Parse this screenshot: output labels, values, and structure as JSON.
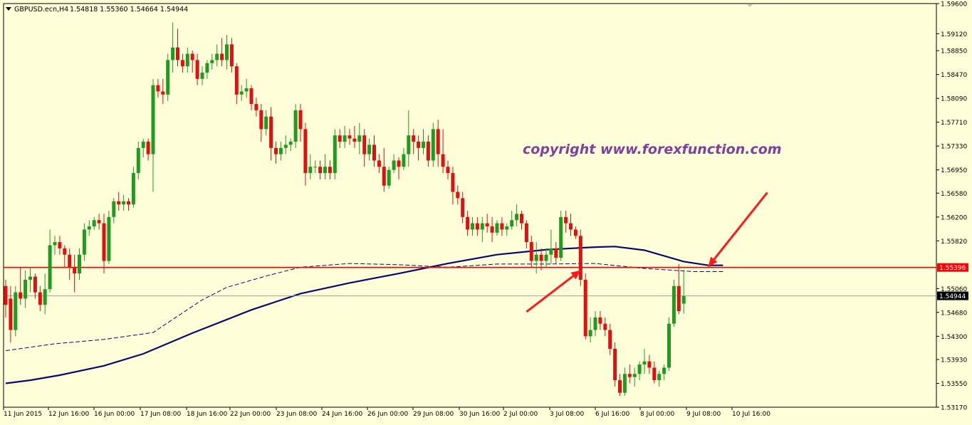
{
  "header": {
    "dropdown_icon": "triangle-down-icon",
    "symbol": "GBPUSD.ecn,H4",
    "ohlc": "1.54818 1.55360 1.54664 1.54944"
  },
  "watermark": "copyright  www.forexfunction.com",
  "colors": {
    "background": "#fefed8",
    "bull": "#1f9c1f",
    "bear": "#e01010",
    "ma": "#0a0a6e",
    "resistance": "#ff0000",
    "watermark": "#8040a0",
    "arrow": "#ff1a1a"
  },
  "chart_data": {
    "type": "candlestick",
    "instrument": "GBPUSD.ecn",
    "timeframe": "H4",
    "ylim": [
      1.5317,
      1.596
    ],
    "y_ticks": [
      "1.59600",
      "1.59120",
      "1.58850",
      "1.58470",
      "1.58090",
      "1.57710",
      "1.57330",
      "1.56950",
      "1.56580",
      "1.56200",
      "1.55820",
      "1.55060",
      "1.54680",
      "1.54300",
      "1.53930",
      "1.53550",
      "1.53170"
    ],
    "x_labels": [
      "11 Jun 2015",
      "12 Jun 16:00",
      "16 Jun 00:00",
      "17 Jun 08:00",
      "18 Jun 16:00",
      "22 Jun 00:00",
      "23 Jun 08:00",
      "24 Jun 16:00",
      "26 Jun 00:00",
      "29 Jun 08:00",
      "30 Jun 16:00",
      "2 Jul 00:00",
      "3 Jul 08:00",
      "6 Jul 16:00",
      "8 Jul 00:00",
      "9 Jul 08:00",
      "10 Jul 16:00"
    ],
    "resistance_level": {
      "label": "1.55396",
      "value": 1.55396
    },
    "current_price": {
      "label": "1.54944",
      "value": 1.54944
    },
    "candles": [
      [
        1.551,
        1.552,
        1.546,
        1.548
      ],
      [
        1.549,
        1.551,
        1.542,
        1.544
      ],
      [
        1.544,
        1.551,
        1.543,
        1.55
      ],
      [
        1.55,
        1.554,
        1.548,
        1.549
      ],
      [
        1.549,
        1.5535,
        1.5475,
        1.552
      ],
      [
        1.552,
        1.554,
        1.55,
        1.5525
      ],
      [
        1.5525,
        1.553,
        1.549,
        1.55
      ],
      [
        1.55,
        1.551,
        1.547,
        1.548
      ],
      [
        1.548,
        1.553,
        1.5465,
        1.5505
      ],
      [
        1.5505,
        1.56,
        1.55,
        1.5575
      ],
      [
        1.5575,
        1.559,
        1.556,
        1.558
      ],
      [
        1.558,
        1.559,
        1.556,
        1.557
      ],
      [
        1.557,
        1.5575,
        1.554,
        1.556
      ],
      [
        1.556,
        1.557,
        1.552,
        1.554
      ],
      [
        1.554,
        1.556,
        1.55,
        1.553
      ],
      [
        1.553,
        1.557,
        1.552,
        1.556
      ],
      [
        1.556,
        1.561,
        1.555,
        1.56
      ],
      [
        1.56,
        1.5615,
        1.559,
        1.5605
      ],
      [
        1.5605,
        1.562,
        1.56,
        1.5615
      ],
      [
        1.5615,
        1.5625,
        1.56,
        1.561
      ],
      [
        1.561,
        1.5625,
        1.553,
        1.555
      ],
      [
        1.555,
        1.563,
        1.5545,
        1.562
      ],
      [
        1.562,
        1.565,
        1.561,
        1.5645
      ],
      [
        1.5645,
        1.566,
        1.563,
        1.564
      ],
      [
        1.564,
        1.5655,
        1.563,
        1.5645
      ],
      [
        1.5645,
        1.565,
        1.563,
        1.564
      ],
      [
        1.564,
        1.57,
        1.5635,
        1.569
      ],
      [
        1.569,
        1.574,
        1.568,
        1.573
      ],
      [
        1.573,
        1.5745,
        1.5715,
        1.574
      ],
      [
        1.574,
        1.5745,
        1.571,
        1.572
      ],
      [
        1.572,
        1.584,
        1.566,
        1.583
      ],
      [
        1.583,
        1.584,
        1.581,
        1.582
      ],
      [
        1.582,
        1.584,
        1.58,
        1.5815
      ],
      [
        1.5815,
        1.588,
        1.5805,
        1.587
      ],
      [
        1.587,
        1.593,
        1.585,
        1.589
      ],
      [
        1.589,
        1.592,
        1.586,
        1.587
      ],
      [
        1.587,
        1.588,
        1.585,
        1.586
      ],
      [
        1.586,
        1.589,
        1.585,
        1.588
      ],
      [
        1.588,
        1.5885,
        1.585,
        1.587
      ],
      [
        1.587,
        1.588,
        1.583,
        1.584
      ],
      [
        1.584,
        1.586,
        1.583,
        1.585
      ],
      [
        1.585,
        1.587,
        1.584,
        1.5865
      ],
      [
        1.5865,
        1.588,
        1.5855,
        1.587
      ],
      [
        1.587,
        1.5895,
        1.586,
        1.588
      ],
      [
        1.588,
        1.5905,
        1.586,
        1.587
      ],
      [
        1.587,
        1.591,
        1.5855,
        1.5895
      ],
      [
        1.5895,
        1.5905,
        1.585,
        1.586
      ],
      [
        1.586,
        1.5865,
        1.58,
        1.5815
      ],
      [
        1.5815,
        1.583,
        1.5805,
        1.582
      ],
      [
        1.582,
        1.584,
        1.581,
        1.5825
      ],
      [
        1.5825,
        1.583,
        1.579,
        1.58
      ],
      [
        1.58,
        1.581,
        1.578,
        1.579
      ],
      [
        1.579,
        1.58,
        1.574,
        1.576
      ],
      [
        1.576,
        1.579,
        1.575,
        1.578
      ],
      [
        1.578,
        1.5795,
        1.571,
        1.573
      ],
      [
        1.573,
        1.574,
        1.5705,
        1.572
      ],
      [
        1.572,
        1.574,
        1.571,
        1.573
      ],
      [
        1.573,
        1.575,
        1.572,
        1.5735
      ],
      [
        1.5735,
        1.5745,
        1.5725,
        1.574
      ],
      [
        1.574,
        1.58,
        1.573,
        1.579
      ],
      [
        1.579,
        1.58,
        1.574,
        1.576
      ],
      [
        1.576,
        1.577,
        1.567,
        1.569
      ],
      [
        1.569,
        1.572,
        1.568,
        1.57
      ],
      [
        1.57,
        1.571,
        1.569,
        1.57
      ],
      [
        1.57,
        1.571,
        1.568,
        1.569
      ],
      [
        1.569,
        1.572,
        1.568,
        1.57
      ],
      [
        1.57,
        1.571,
        1.568,
        1.569
      ],
      [
        1.569,
        1.576,
        1.568,
        1.575
      ],
      [
        1.575,
        1.576,
        1.573,
        1.574
      ],
      [
        1.574,
        1.5765,
        1.573,
        1.575
      ],
      [
        1.575,
        1.576,
        1.5735,
        1.5745
      ],
      [
        1.5745,
        1.5765,
        1.573,
        1.574
      ],
      [
        1.574,
        1.577,
        1.572,
        1.575
      ],
      [
        1.575,
        1.576,
        1.57,
        1.572
      ],
      [
        1.572,
        1.5745,
        1.571,
        1.5735
      ],
      [
        1.5735,
        1.575,
        1.57,
        1.571
      ],
      [
        1.571,
        1.572,
        1.569,
        1.57
      ],
      [
        1.57,
        1.573,
        1.566,
        1.567
      ],
      [
        1.567,
        1.57,
        1.5665,
        1.5695
      ],
      [
        1.5695,
        1.572,
        1.569,
        1.571
      ],
      [
        1.571,
        1.5715,
        1.568,
        1.57
      ],
      [
        1.57,
        1.573,
        1.5695,
        1.572
      ],
      [
        1.572,
        1.579,
        1.57,
        1.575
      ],
      [
        1.575,
        1.576,
        1.572,
        1.574
      ],
      [
        1.574,
        1.575,
        1.571,
        1.573
      ],
      [
        1.573,
        1.576,
        1.572,
        1.574
      ],
      [
        1.574,
        1.575,
        1.57,
        1.571
      ],
      [
        1.571,
        1.577,
        1.57,
        1.576
      ],
      [
        1.576,
        1.5775,
        1.57,
        1.572
      ],
      [
        1.572,
        1.576,
        1.569,
        1.57
      ],
      [
        1.57,
        1.571,
        1.568,
        1.569
      ],
      [
        1.569,
        1.57,
        1.564,
        1.566
      ],
      [
        1.566,
        1.567,
        1.564,
        1.565
      ],
      [
        1.565,
        1.566,
        1.561,
        1.562
      ],
      [
        1.562,
        1.563,
        1.559,
        1.56
      ],
      [
        1.56,
        1.562,
        1.559,
        1.561
      ],
      [
        1.561,
        1.562,
        1.559,
        1.56
      ],
      [
        1.56,
        1.562,
        1.558,
        1.561
      ],
      [
        1.561,
        1.5625,
        1.5595,
        1.5605
      ],
      [
        1.5605,
        1.562,
        1.558,
        1.5595
      ],
      [
        1.5595,
        1.5615,
        1.559,
        1.561
      ],
      [
        1.561,
        1.562,
        1.559,
        1.56
      ],
      [
        1.56,
        1.561,
        1.559,
        1.5605
      ],
      [
        1.5605,
        1.563,
        1.56,
        1.5615
      ],
      [
        1.5615,
        1.564,
        1.5605,
        1.5625
      ],
      [
        1.5625,
        1.563,
        1.56,
        1.561
      ],
      [
        1.561,
        1.5615,
        1.557,
        1.558
      ],
      [
        1.558,
        1.559,
        1.554,
        1.555
      ],
      [
        1.555,
        1.558,
        1.553,
        1.556
      ],
      [
        1.556,
        1.557,
        1.5535,
        1.555
      ],
      [
        1.555,
        1.557,
        1.554,
        1.556
      ],
      [
        1.556,
        1.56,
        1.5545,
        1.557
      ],
      [
        1.557,
        1.558,
        1.5545,
        1.5555
      ],
      [
        1.5555,
        1.563,
        1.555,
        1.562
      ],
      [
        1.562,
        1.563,
        1.5595,
        1.561
      ],
      [
        1.561,
        1.5625,
        1.559,
        1.56
      ],
      [
        1.56,
        1.5605,
        1.5585,
        1.559
      ],
      [
        1.559,
        1.56,
        1.551,
        1.552
      ],
      [
        1.552,
        1.553,
        1.5425,
        1.543
      ],
      [
        1.543,
        1.546,
        1.542,
        1.544
      ],
      [
        1.544,
        1.547,
        1.543,
        1.546
      ],
      [
        1.546,
        1.547,
        1.544,
        1.545
      ],
      [
        1.545,
        1.546,
        1.543,
        1.544
      ],
      [
        1.544,
        1.545,
        1.54,
        1.541
      ],
      [
        1.541,
        1.542,
        1.535,
        1.536
      ],
      [
        1.536,
        1.537,
        1.5335,
        1.534
      ],
      [
        1.534,
        1.538,
        1.5335,
        1.537
      ],
      [
        1.537,
        1.5385,
        1.5355,
        1.5365
      ],
      [
        1.5365,
        1.538,
        1.535,
        1.537
      ],
      [
        1.537,
        1.539,
        1.536,
        1.5385
      ],
      [
        1.5385,
        1.541,
        1.537,
        1.539
      ],
      [
        1.539,
        1.54,
        1.537,
        1.538
      ],
      [
        1.538,
        1.539,
        1.5355,
        1.536
      ],
      [
        1.536,
        1.5375,
        1.535,
        1.537
      ],
      [
        1.537,
        1.5385,
        1.536,
        1.538
      ],
      [
        1.538,
        1.546,
        1.5375,
        1.545
      ],
      [
        1.545,
        1.552,
        1.5445,
        1.551
      ],
      [
        1.551,
        1.5545,
        1.5465,
        1.547
      ],
      [
        1.5482,
        1.5536,
        1.5466,
        1.5494
      ]
    ],
    "moving_average_solid": [
      [
        0,
        1.5355
      ],
      [
        5,
        1.536
      ],
      [
        11,
        1.5368
      ],
      [
        20,
        1.5383
      ],
      [
        28,
        1.5402
      ],
      [
        38,
        1.5435
      ],
      [
        50,
        1.5472
      ],
      [
        60,
        1.5498
      ],
      [
        70,
        1.5515
      ],
      [
        80,
        1.553
      ],
      [
        90,
        1.5546
      ],
      [
        100,
        1.556
      ],
      [
        110,
        1.5568
      ],
      [
        120,
        1.5572
      ],
      [
        124,
        1.5573
      ],
      [
        130,
        1.5567
      ],
      [
        138,
        1.5549
      ],
      [
        143,
        1.5543
      ],
      [
        146,
        1.5543
      ]
    ],
    "moving_average_dashed": [
      [
        0,
        1.5407
      ],
      [
        10,
        1.5418
      ],
      [
        20,
        1.5425
      ],
      [
        30,
        1.5436
      ],
      [
        35,
        1.5462
      ],
      [
        40,
        1.5488
      ],
      [
        45,
        1.5508
      ],
      [
        53,
        1.5526
      ],
      [
        60,
        1.554
      ],
      [
        70,
        1.5546
      ],
      [
        80,
        1.5544
      ],
      [
        90,
        1.554
      ],
      [
        100,
        1.5545
      ],
      [
        110,
        1.5545
      ],
      [
        120,
        1.5546
      ],
      [
        130,
        1.5538
      ],
      [
        140,
        1.5533
      ],
      [
        146,
        1.5533
      ]
    ],
    "annotation_arrows": [
      {
        "from": [
          106,
          1.5469
        ],
        "to": [
          117,
          1.5535
        ]
      },
      {
        "from": [
          155,
          1.5659
        ],
        "to": [
          143,
          1.5541
        ]
      }
    ]
  }
}
